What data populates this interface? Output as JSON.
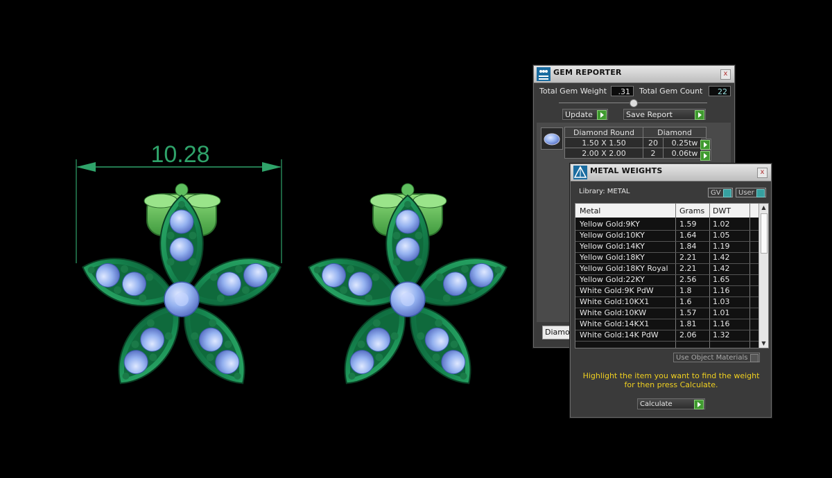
{
  "viewport": {
    "dimension_label": "10.28"
  },
  "gem_reporter": {
    "title": "GEM REPORTER",
    "close": "x",
    "total_weight_label": "Total Gem Weight",
    "total_weight_value": ".31",
    "total_count_label": "Total Gem Count",
    "total_count_value": "22",
    "update_label": "Update",
    "save_report_label": "Save Report",
    "table": {
      "col1": "Diamond Round",
      "col2": "Diamond",
      "rows": [
        {
          "size": "1.50 X 1.50",
          "count": "20",
          "weight": "0.25tw"
        },
        {
          "size": "2.00 X 2.00",
          "count": "2",
          "weight": "0.06tw"
        }
      ]
    },
    "footer_partial": "Diamon"
  },
  "metal_weights": {
    "title": "METAL WEIGHTS",
    "close": "x",
    "library_label": "Library: METAL",
    "gv_label": "GV",
    "user_label": "User",
    "columns": {
      "metal": "Metal",
      "grams": "Grams",
      "dwt": "DWT"
    },
    "rows": [
      {
        "metal": "Yellow Gold:9KY",
        "grams": "1.59",
        "dwt": "1.02"
      },
      {
        "metal": "Yellow Gold:10KY",
        "grams": "1.64",
        "dwt": "1.05"
      },
      {
        "metal": "Yellow Gold:14KY",
        "grams": "1.84",
        "dwt": "1.19"
      },
      {
        "metal": "Yellow Gold:18KY",
        "grams": "2.21",
        "dwt": "1.42"
      },
      {
        "metal": "Yellow Gold:18KY Royal",
        "grams": "2.21",
        "dwt": "1.42"
      },
      {
        "metal": "Yellow Gold:22KY",
        "grams": "2.56",
        "dwt": "1.65"
      },
      {
        "metal": "White Gold:9K PdW",
        "grams": "1.8",
        "dwt": "1.16"
      },
      {
        "metal": "White Gold:10KX1",
        "grams": "1.6",
        "dwt": "1.03"
      },
      {
        "metal": "White Gold:10KW",
        "grams": "1.57",
        "dwt": "1.01"
      },
      {
        "metal": "White Gold:14KX1",
        "grams": "1.81",
        "dwt": "1.16"
      },
      {
        "metal": "White Gold:14K PdW",
        "grams": "2.06",
        "dwt": "1.32"
      }
    ],
    "use_object_materials_label": "Use Object Materials",
    "hint_line1": "Highlight the item you want to find the weight",
    "hint_line2": "for then press Calculate.",
    "calculate_label": "Calculate"
  },
  "colors": {
    "metal_green": "#1f7a4a",
    "gem_blue": "#8fb0f0",
    "dimension_green": "#2fa36a",
    "hint_yellow": "#f0d020"
  }
}
